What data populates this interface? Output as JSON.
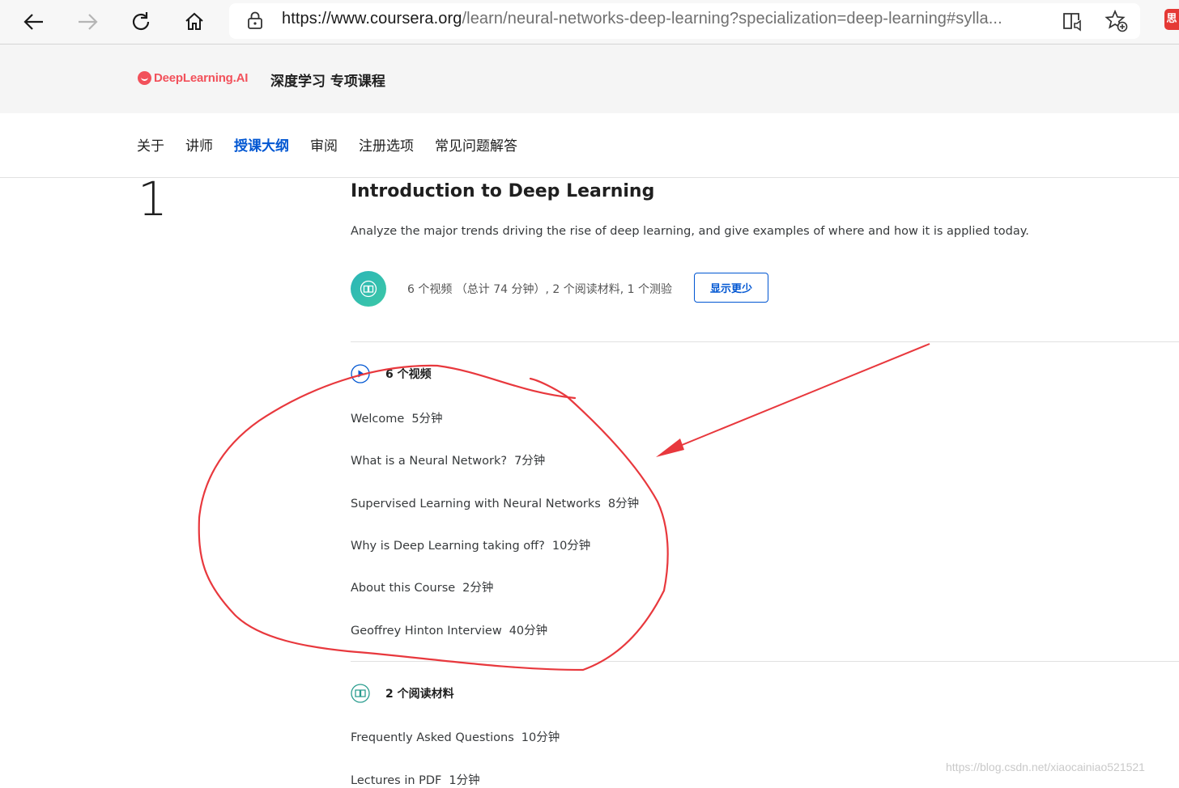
{
  "browser": {
    "url_host": "https://www.coursera.org",
    "url_path": "/learn/neural-networks-deep-learning?specialization=deep-learning#sylla...",
    "extension_badge": "思"
  },
  "header": {
    "logo_text": "DeepLearning.AI",
    "specialization_title": "深度学习 专项课程"
  },
  "tabs": [
    {
      "label": "关于"
    },
    {
      "label": "讲师"
    },
    {
      "label": "授课大纲",
      "active": true
    },
    {
      "label": "审阅"
    },
    {
      "label": "注册选项"
    },
    {
      "label": "常见问题解答"
    }
  ],
  "week": {
    "number": "1",
    "title": "Introduction to Deep Learning",
    "description": "Analyze the major trends driving the rise of deep learning, and give examples of where and how it is applied today.",
    "summary": "6 个视频 （总计 74 分钟）, 2 个阅读材料, 1 个测验",
    "toggle_label": "显示更少"
  },
  "videos": {
    "heading": "6 个视频",
    "items": [
      {
        "title": "Welcome",
        "duration": "5分钟"
      },
      {
        "title": "What is a Neural Network?",
        "duration": "7分钟"
      },
      {
        "title": "Supervised Learning with Neural Networks",
        "duration": "8分钟"
      },
      {
        "title": "Why is Deep Learning taking off?",
        "duration": "10分钟"
      },
      {
        "title": "About this Course",
        "duration": "2分钟"
      },
      {
        "title": "Geoffrey Hinton Interview",
        "duration": "40分钟"
      }
    ]
  },
  "readings": {
    "heading": "2 个阅读材料",
    "items": [
      {
        "title": "Frequently Asked Questions",
        "duration": "10分钟"
      },
      {
        "title": "Lectures in PDF",
        "duration": "1分钟"
      }
    ]
  },
  "watermark": "https://blog.csdn.net/xiaocainiao521521",
  "colors": {
    "accent": "#0056d2",
    "annotation": "#e8383d",
    "brand": "#f2515b"
  }
}
